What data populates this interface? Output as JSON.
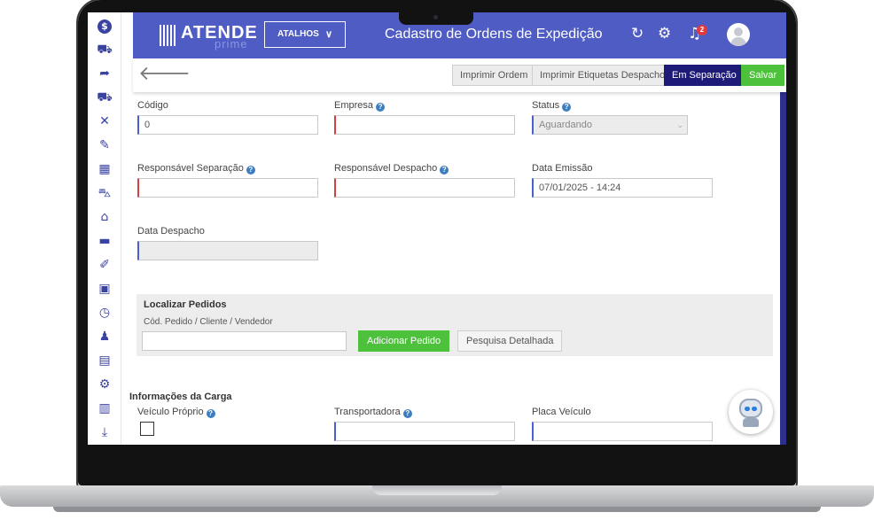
{
  "app": {
    "logo_text": "ATENDE",
    "logo_subtext": "prime",
    "shortcuts_label": "ATALHOS",
    "page_title": "Cadastro de Ordens de Expedição",
    "notification_count": "2"
  },
  "sidebar_icons": [
    "dollar-icon",
    "cart-icon",
    "share-icon",
    "cart-plus-icon",
    "tools-icon",
    "edit-doc-icon",
    "boxes-icon",
    "truck-icon",
    "warehouse-icon",
    "car-icon",
    "pen-icon",
    "monitor-icon",
    "clock-icon",
    "users-icon",
    "report-icon",
    "settings-icon",
    "bar-chart-icon",
    "download-icon"
  ],
  "toolbar": {
    "print_order": "Imprimir Ordem",
    "print_labels": "Imprimir Etiquetas Despacho",
    "in_separation": "Em Separação",
    "save": "Salvar"
  },
  "form": {
    "codigo": {
      "label": "Código",
      "value": "0"
    },
    "empresa": {
      "label": "Empresa",
      "value": ""
    },
    "status": {
      "label": "Status",
      "value": "Aguardando"
    },
    "resp_separacao": {
      "label": "Responsável Separação",
      "value": ""
    },
    "resp_despacho": {
      "label": "Responsável Despacho",
      "value": ""
    },
    "data_emissao": {
      "label": "Data Emissão",
      "value": "07/01/2025 - 14:24"
    },
    "data_despacho": {
      "label": "Data Despacho",
      "value": ""
    }
  },
  "search": {
    "title": "Localizar Pedidos",
    "subtitle": "Cód. Pedido / Cliente / Vendedor",
    "value": "",
    "add_button": "Adicionar Pedido",
    "detailed_button": "Pesquisa Detalhada"
  },
  "cargo": {
    "title": "Informações da Carga",
    "own_vehicle_label": "Veículo Próprio",
    "own_vehicle_checked": false,
    "carrier_label": "Transportadora",
    "carrier_value": "",
    "plate_label": "Placa Veículo",
    "plate_value": ""
  },
  "colors": {
    "topbar": "#4f5cc4",
    "primary_dark": "#1d1a78",
    "success": "#4dc03c",
    "required_border": "#d24040",
    "info_border": "#4a5fd0"
  }
}
